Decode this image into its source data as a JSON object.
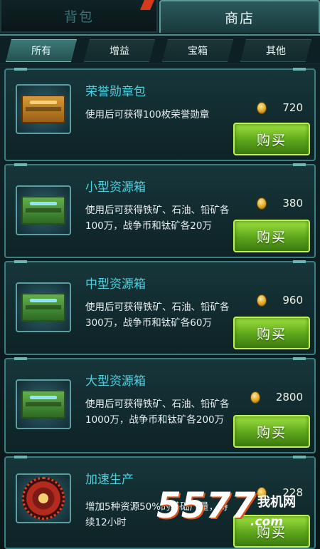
{
  "top_tabs": {
    "backpack": "背包",
    "shop": "商店"
  },
  "filter_tabs": [
    "所有",
    "增益",
    "宝箱",
    "其他"
  ],
  "items": [
    {
      "name": "荣誉勋章包",
      "desc": "使用后可获得100枚荣誉勋章",
      "price": "720",
      "buy": "购买",
      "icon": "gold-crate-icon"
    },
    {
      "name": "小型资源箱",
      "desc": "使用后可获得铁矿、石油、铅矿各100万，战争币和钛矿各20万",
      "price": "380",
      "buy": "购买",
      "icon": "small-resource-crate-icon"
    },
    {
      "name": "中型资源箱",
      "desc": "使用后可获得铁矿、石油、铅矿各300万，战争币和钛矿各60万",
      "price": "960",
      "buy": "购买",
      "icon": "medium-resource-crate-icon"
    },
    {
      "name": "大型资源箱",
      "desc": "使用后可获得铁矿、石油、铅矿各1000万，战争币和钛矿各200万",
      "price": "2800",
      "buy": "购买",
      "icon": "large-resource-crate-icon"
    },
    {
      "name": "加速生产",
      "desc": "增加5种资源50%的基础产量，持续12小时",
      "price": "228",
      "buy": "购买",
      "icon": "gear-speedup-icon"
    }
  ],
  "watermark": {
    "number": "5577",
    "site": "我机网",
    "domain": ".com"
  },
  "colors": {
    "accent_cyan": "#4fd0e0",
    "buy_green": "#5da51b",
    "frame": "#3d7e80"
  }
}
